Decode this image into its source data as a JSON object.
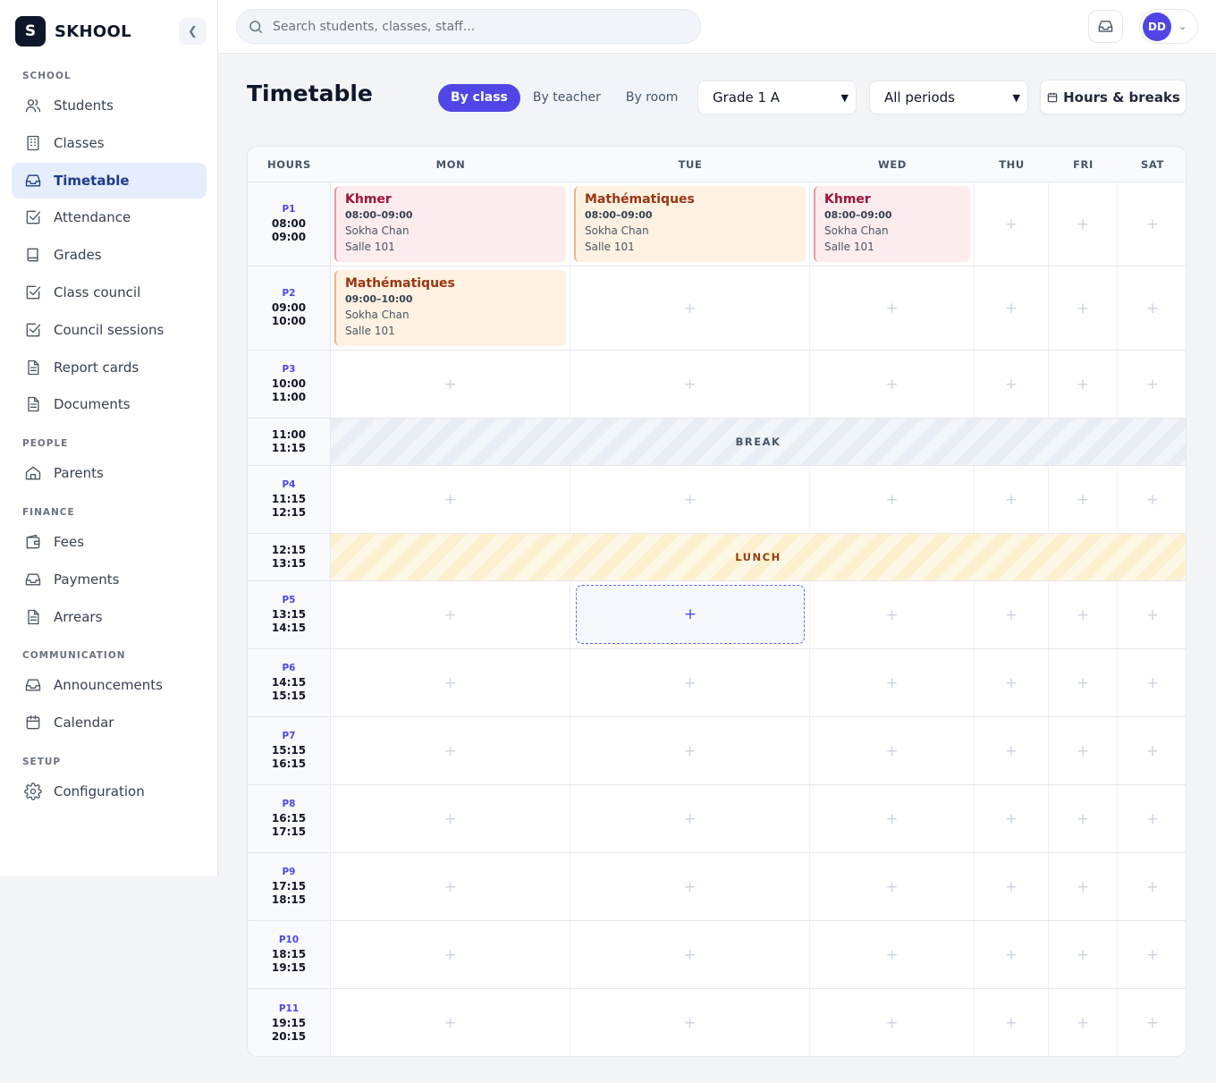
{
  "brand": {
    "logo_letter": "S",
    "name": "SKHOOL"
  },
  "sidebar": {
    "collapse_icon": "chevron-left-icon",
    "sections": [
      {
        "title": "SCHOOL",
        "items": [
          {
            "label": "Students",
            "icon": "users-icon"
          },
          {
            "label": "Classes",
            "icon": "building-icon"
          },
          {
            "label": "Timetable",
            "icon": "inbox-icon",
            "active": true
          },
          {
            "label": "Attendance",
            "icon": "checkbox-icon"
          },
          {
            "label": "Grades",
            "icon": "book-icon"
          },
          {
            "label": "Class council",
            "icon": "checkbox-icon"
          },
          {
            "label": "Council sessions",
            "icon": "checkbox-icon"
          },
          {
            "label": "Report cards",
            "icon": "document-icon"
          },
          {
            "label": "Documents",
            "icon": "document-icon"
          }
        ]
      },
      {
        "title": "PEOPLE",
        "items": [
          {
            "label": "Parents",
            "icon": "home-icon"
          }
        ]
      },
      {
        "title": "FINANCE",
        "items": [
          {
            "label": "Fees",
            "icon": "wallet-icon"
          },
          {
            "label": "Payments",
            "icon": "inbox-icon"
          },
          {
            "label": "Arrears",
            "icon": "document-icon"
          }
        ]
      },
      {
        "title": "COMMUNICATION",
        "items": [
          {
            "label": "Announcements",
            "icon": "inbox-icon"
          },
          {
            "label": "Calendar",
            "icon": "calendar-icon"
          }
        ]
      },
      {
        "title": "SETUP",
        "items": [
          {
            "label": "Configuration",
            "icon": "gear-icon"
          }
        ]
      }
    ]
  },
  "topbar": {
    "search_placeholder": "Search students, classes, staff...",
    "user_initials": "DD"
  },
  "header": {
    "title": "Timetable",
    "view_tabs": [
      "By class",
      "By teacher",
      "By room"
    ],
    "active_view": "By class",
    "class_select": "Grade 1 A",
    "period_select": "All periods",
    "hours_button": "Hours & breaks"
  },
  "timetable": {
    "hours_header": "HOURS",
    "days": [
      "MON",
      "TUE",
      "WED",
      "THU",
      "FRI",
      "SAT"
    ],
    "rows": [
      {
        "type": "period",
        "period": "P1",
        "start": "08:00",
        "end": "09:00"
      },
      {
        "type": "period",
        "period": "P2",
        "start": "09:00",
        "end": "10:00"
      },
      {
        "type": "period",
        "period": "P3",
        "start": "10:00",
        "end": "11:00"
      },
      {
        "type": "break",
        "label": "BREAK",
        "start": "11:00",
        "end": "11:15",
        "color": "gray"
      },
      {
        "type": "period",
        "period": "P4",
        "start": "11:15",
        "end": "12:15"
      },
      {
        "type": "break",
        "label": "LUNCH",
        "start": "12:15",
        "end": "13:15",
        "color": "yellow"
      },
      {
        "type": "period",
        "period": "P5",
        "start": "13:15",
        "end": "14:15"
      },
      {
        "type": "period",
        "period": "P6",
        "start": "14:15",
        "end": "15:15"
      },
      {
        "type": "period",
        "period": "P7",
        "start": "15:15",
        "end": "16:15"
      },
      {
        "type": "period",
        "period": "P8",
        "start": "16:15",
        "end": "17:15"
      },
      {
        "type": "period",
        "period": "P9",
        "start": "17:15",
        "end": "18:15"
      },
      {
        "type": "period",
        "period": "P10",
        "start": "18:15",
        "end": "19:15"
      },
      {
        "type": "period",
        "period": "P11",
        "start": "19:15",
        "end": "20:15"
      }
    ],
    "lessons": [
      {
        "row": 0,
        "day": 0,
        "subject": "Khmer",
        "time": "08:00–09:00",
        "teacher": "Sokha Chan",
        "room": "Salle 101",
        "color": "red"
      },
      {
        "row": 0,
        "day": 1,
        "subject": "Mathématiques",
        "time": "08:00–09:00",
        "teacher": "Sokha Chan",
        "room": "Salle 101",
        "color": "orange"
      },
      {
        "row": 0,
        "day": 2,
        "subject": "Khmer",
        "time": "08:00–09:00",
        "teacher": "Sokha Chan",
        "room": "Salle 101",
        "color": "red"
      },
      {
        "row": 1,
        "day": 0,
        "subject": "Mathématiques",
        "time": "09:00–10:00",
        "teacher": "Sokha Chan",
        "room": "Salle 101",
        "color": "orange"
      }
    ],
    "highlight_cell": {
      "row": 6,
      "day": 1
    },
    "add_glyph": "+"
  }
}
